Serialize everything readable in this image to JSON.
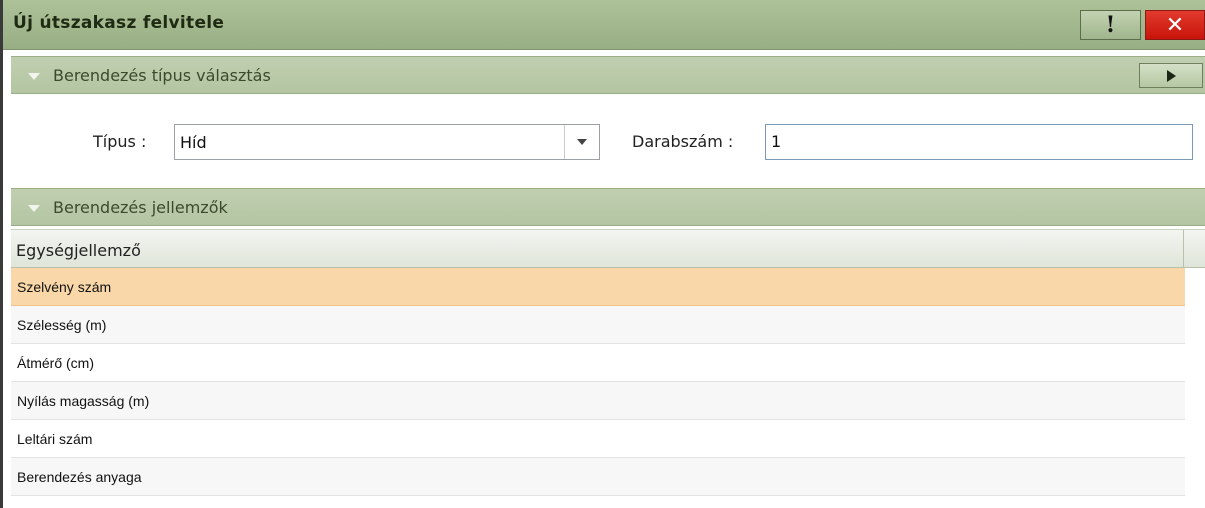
{
  "window": {
    "title": "Új útszakasz felvitele",
    "warn_label": "!",
    "close_label": "✕"
  },
  "section_type": {
    "title": "Berendezés típus választás"
  },
  "form": {
    "type_label": "Típus :",
    "type_value": "Híd",
    "count_label": "Darabszám :",
    "count_value": "1"
  },
  "section_props": {
    "title": "Berendezés jellemzők"
  },
  "grid": {
    "header": "Egységjellemző",
    "rows": [
      "Szelvény szám",
      "Szélesség (m)",
      "Átmérő (cm)",
      "Nyílás magasság (m)",
      "Leltári szám",
      "Berendezés anyaga"
    ]
  },
  "colors": {
    "header_green": "#98ae84",
    "section_green": "#b3c5a2",
    "selected_row": "#f9d7a8",
    "close_red": "#d0201a"
  }
}
